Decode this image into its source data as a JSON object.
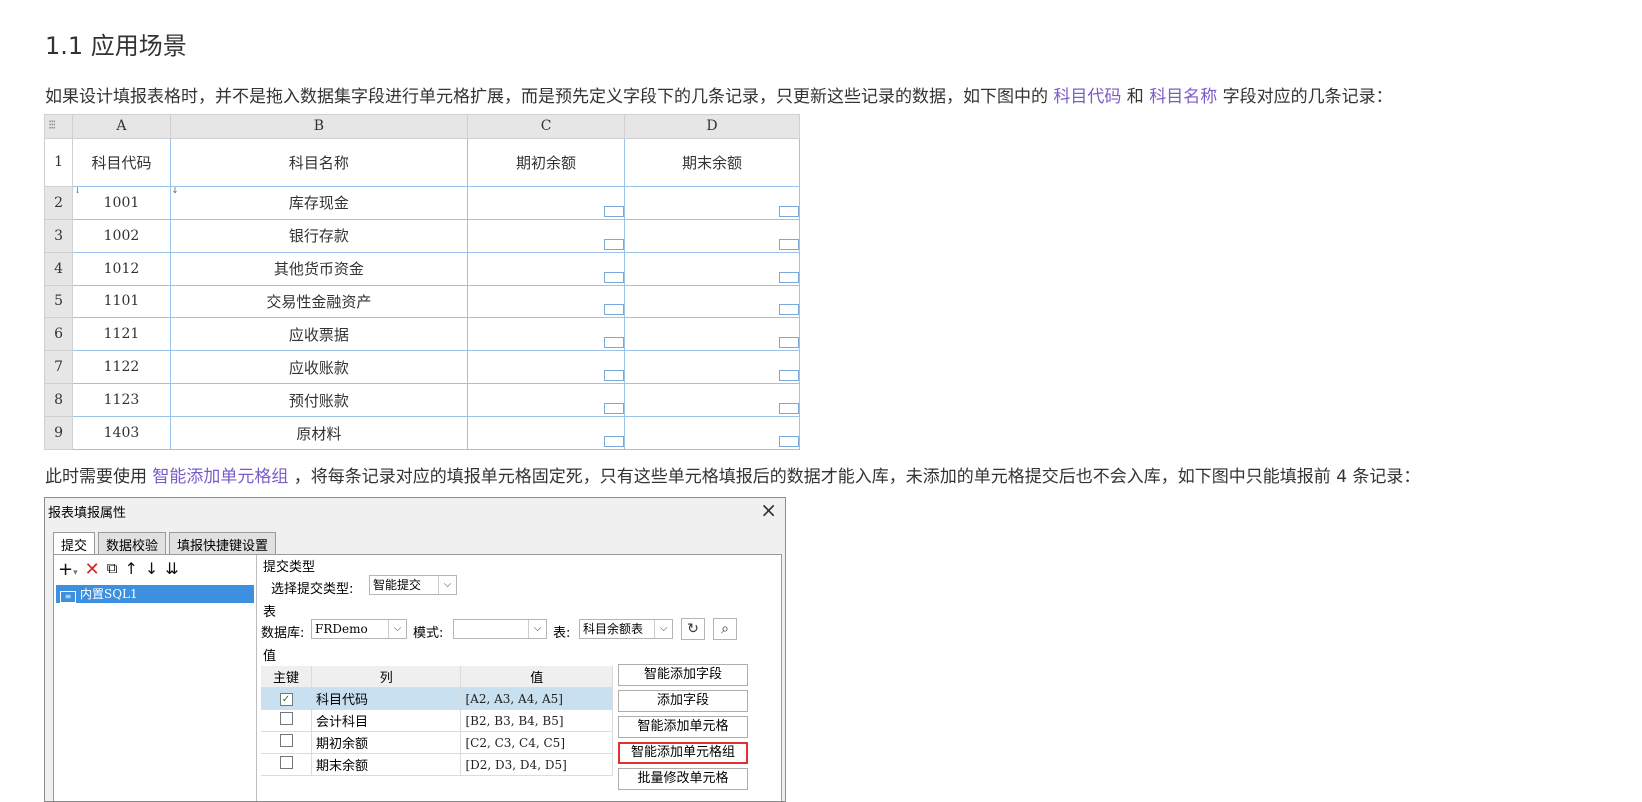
{
  "heading": "1.1 应用场景",
  "para1": {
    "before": "如果设计填报表格时，并不是拖入数据集字段进行单元格扩展，而是预先定义字段下的几条记录，只更新这些记录的数据，如下图中的 ",
    "link1": "科目代码",
    "mid": " 和 ",
    "link2": "科目名称",
    "after": " 字段对应的几条记录："
  },
  "sheet": {
    "columns": [
      "A",
      "B",
      "C",
      "D"
    ],
    "header": [
      "科目代码",
      "科目名称",
      "期初余额",
      "期末余额"
    ],
    "row_numbers": [
      "1",
      "2",
      "3",
      "4",
      "5",
      "6",
      "7",
      "8",
      "9"
    ],
    "rows": [
      {
        "code": "1001",
        "name": "库存现金"
      },
      {
        "code": "1002",
        "name": "银行存款"
      },
      {
        "code": "1012",
        "name": "其他货币资金"
      },
      {
        "code": "1101",
        "name": "交易性金融资产"
      },
      {
        "code": "1121",
        "name": "应收票据"
      },
      {
        "code": "1122",
        "name": "应收账款"
      },
      {
        "code": "1123",
        "name": "预付账款"
      },
      {
        "code": "1403",
        "name": "原材料"
      }
    ]
  },
  "para2": {
    "before": "此时需要使用 ",
    "link": "智能添加单元格组",
    "after": " ，将每条记录对应的填报单元格固定死，只有这些单元格填报后的数据才能入库，未添加的单元格提交后也不会入库，如下图中只能填报前 4 条记录："
  },
  "dialog": {
    "title": "报表填报属性",
    "close": "×",
    "tabs": [
      "提交",
      "数据校验",
      "填报快捷键设置"
    ],
    "tree_item": "内置SQL1",
    "submit_type_section": "提交类型",
    "submit_type_label": "选择提交类型:",
    "submit_type_value": "智能提交",
    "table_section": "表",
    "db_label": "数据库:",
    "db_value": "FRDemo",
    "schema_label": "模式:",
    "schema_value": "",
    "table_label": "表:",
    "table_value": "科目余额表",
    "value_section": "值",
    "value_headers": [
      "主键",
      "列",
      "值"
    ],
    "value_rows": [
      {
        "checked": "✓",
        "col": "科目代码",
        "val": "[A2, A3, A4, A5]"
      },
      {
        "checked": "",
        "col": "会计科目",
        "val": "[B2, B3, B4, B5]"
      },
      {
        "checked": "",
        "col": "期初余额",
        "val": "[C2, C3, C4, C5]"
      },
      {
        "checked": "",
        "col": "期末余额",
        "val": "[D2, D3, D4, D5]"
      }
    ],
    "buttons": [
      "智能添加字段",
      "添加字段",
      "智能添加单元格",
      "智能添加单元格组",
      "批量修改单元格"
    ]
  }
}
